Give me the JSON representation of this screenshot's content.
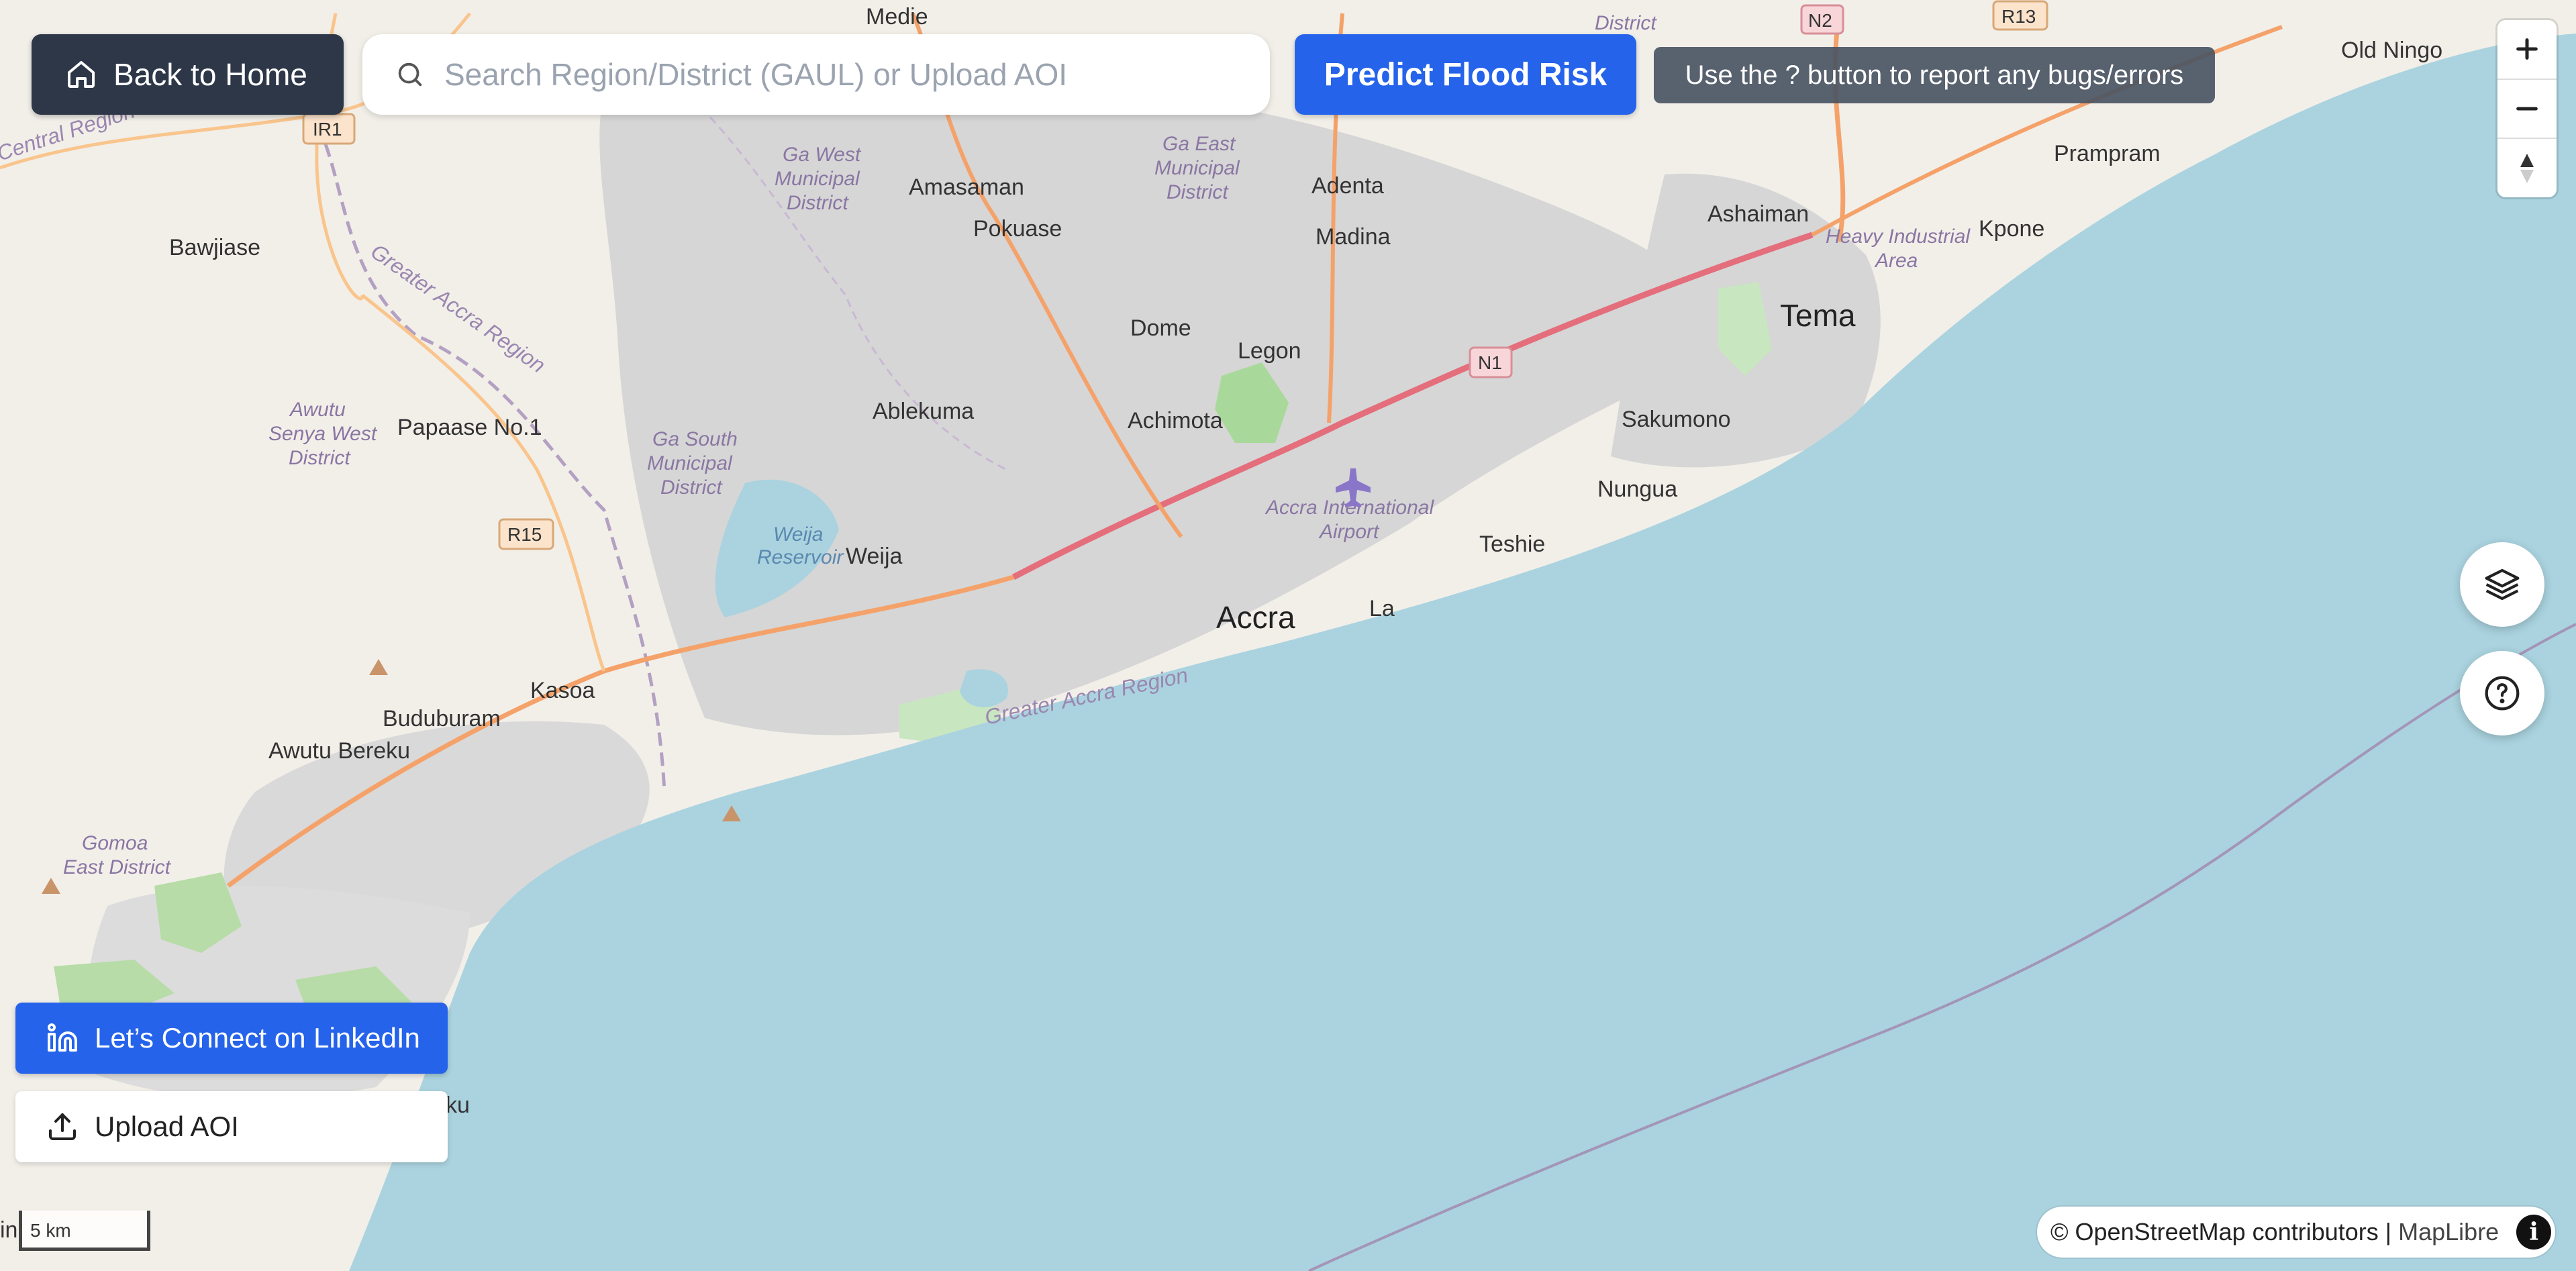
{
  "toolbar": {
    "home_label": "Back to Home",
    "search_placeholder": "Search Region/District (GAUL) or Upload AOI",
    "predict_label": "Predict Flood Risk",
    "notice": "Use the ? button to report any bugs/errors"
  },
  "bottom_left": {
    "linkedin_label": "Let’s Connect on LinkedIn",
    "upload_label": "Upload AOI"
  },
  "scale_bar": "5 km",
  "attribution": {
    "osm": "© OpenStreetMap contributors",
    "separator": "|",
    "maplibre": "MapLibre"
  },
  "zoom_controls": {
    "zoom_in": "+",
    "zoom_out": "−"
  },
  "map_labels": {
    "accra": "Accra",
    "tema": "Tema",
    "achimota": "Achimota",
    "legon": "Legon",
    "dome": "Dome",
    "madina": "Madina",
    "adenta": "Adenta",
    "amasaman": "Amasaman",
    "pokuase": "Pokuase",
    "ablekuma": "Ablekuma",
    "weija": "Weija",
    "kasoa": "Kasoa",
    "buduburam": "Buduburam",
    "awutu_bereku": "Awutu Bereku",
    "papaase": "Papaase No.1",
    "bawjiase": "Bawjiase",
    "sakumono": "Sakumono",
    "nungua": "Nungua",
    "teshie": "Teshie",
    "la": "La",
    "ashaiman": "Ashaiman",
    "kpone": "Kpone",
    "prampram": "Prampram",
    "old_ningo": "Old Ningo",
    "medie": "Medie",
    "airport_1": "Accra International",
    "airport_2": "Airport",
    "heavy_ind_1": "Heavy Industrial",
    "heavy_ind_2": "Area",
    "ga_west_1": "Ga West",
    "ga_west_2": "Municipal",
    "ga_west_3": "District",
    "ga_east_1": "Ga East",
    "ga_east_2": "Municipal",
    "ga_east_3": "District",
    "ga_south_1": "Ga South",
    "ga_south_2": "Municipal",
    "ga_south_3": "District",
    "awutu_senya_1": "Awutu",
    "awutu_senya_2": "Senya West",
    "awutu_senya_3": "District",
    "gomoa_1": "Gomoa",
    "gomoa_2": "East District",
    "weija_res_1": "Weija",
    "weija_res_2": "Reservoir",
    "central_region": "Central Region",
    "greater_accra_1": "Greater Accra Region",
    "greater_accra_2": "Greater Accra Region",
    "district_top": "District",
    "n1": "N1",
    "n2": "N2",
    "r13": "R13",
    "r15": "R15",
    "ir1": "IR1",
    "ku": "ku",
    "in": "in"
  },
  "colors": {
    "sea": "#aad3df",
    "land": "#f2efe9",
    "urban": "#d9d9d9",
    "primary_blue": "#2563eb",
    "dark_button": "#2d3748",
    "highway": "#e46e7b",
    "trunk": "#f4a26a"
  }
}
